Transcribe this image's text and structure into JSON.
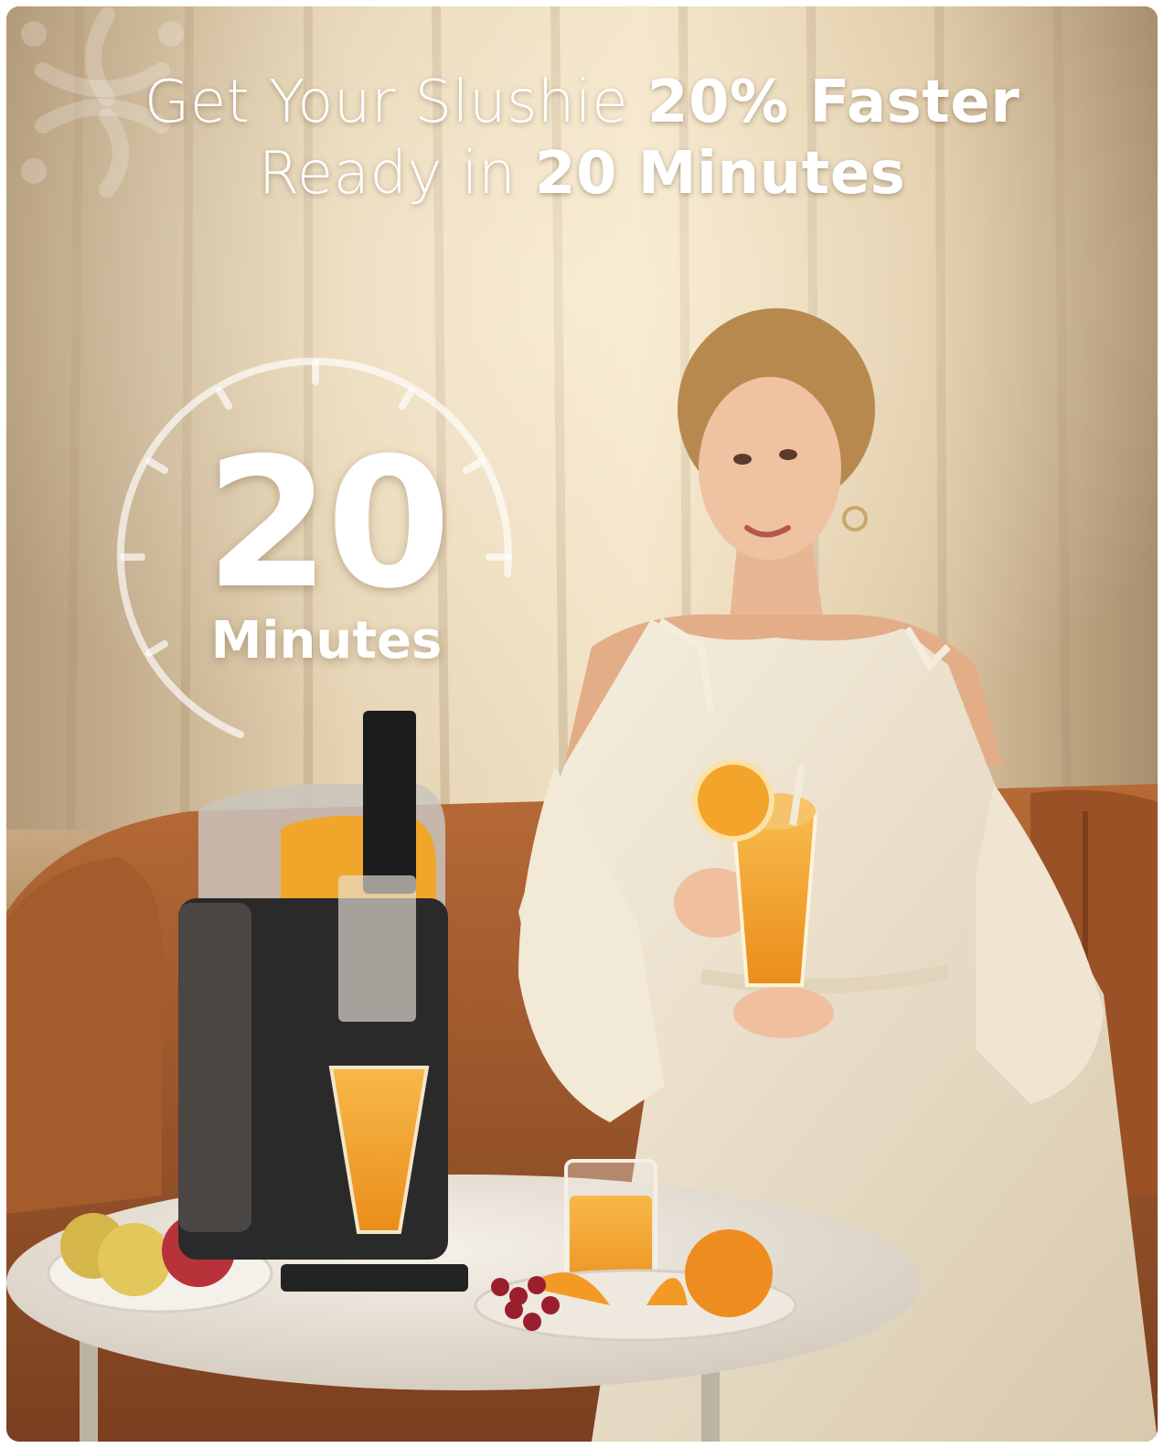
{
  "headline": {
    "line1_regular": "Get Your Slushie ",
    "line1_bold": "20% Faster",
    "line2_regular": "Ready in ",
    "line2_bold": "20 Minutes"
  },
  "timer": {
    "number": "20",
    "unit": "Minutes"
  },
  "colors": {
    "text": "#ffffff",
    "sofa": "#9a5228",
    "dress": "#efe6d3",
    "juice": "#f2a02a",
    "machine": "#2b2a2a"
  }
}
